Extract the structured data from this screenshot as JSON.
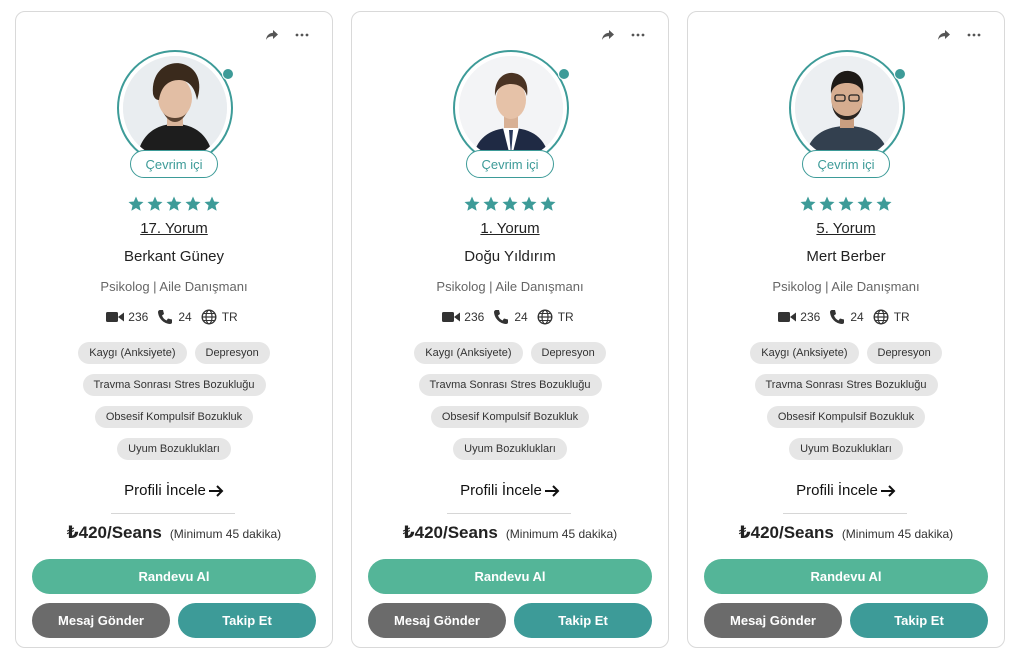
{
  "counselors": [
    {
      "status": "Çevrim içi",
      "reviews": "17. Yorum",
      "name": "Berkant Güney",
      "title": "Psikolog | Aile Danışmanı",
      "video_count": "236",
      "call_count": "24",
      "language": "TR",
      "tags": [
        "Kaygı (Anksiyete)",
        "Depresyon",
        "Travma Sonrası Stres Bozukluğu",
        "Obsesif Kompulsif Bozukluk",
        "Uyum Bozuklukları"
      ],
      "profile_link": "Profili İncele",
      "price": "₺420/Seans",
      "price_note": "(Minimum 45 dakika)",
      "book_label": "Randevu Al",
      "message_label": "Mesaj Gönder",
      "follow_label": "Takip Et"
    },
    {
      "status": "Çevrim içi",
      "reviews": "1. Yorum",
      "name": "Doğu Yıldırım",
      "title": "Psikolog | Aile Danışmanı",
      "video_count": "236",
      "call_count": "24",
      "language": "TR",
      "tags": [
        "Kaygı (Anksiyete)",
        "Depresyon",
        "Travma Sonrası Stres Bozukluğu",
        "Obsesif Kompulsif Bozukluk",
        "Uyum Bozuklukları"
      ],
      "profile_link": "Profili İncele",
      "price": "₺420/Seans",
      "price_note": "(Minimum 45 dakika)",
      "book_label": "Randevu Al",
      "message_label": "Mesaj Gönder",
      "follow_label": "Takip Et"
    },
    {
      "status": "Çevrim içi",
      "reviews": "5. Yorum",
      "name": "Mert Berber",
      "title": "Psikolog | Aile Danışmanı",
      "video_count": "236",
      "call_count": "24",
      "language": "TR",
      "tags": [
        "Kaygı (Anksiyete)",
        "Depresyon",
        "Travma Sonrası Stres Bozukluğu",
        "Obsesif Kompulsif Bozukluk",
        "Uyum Bozuklukları"
      ],
      "profile_link": "Profili İncele",
      "price": "₺420/Seans",
      "price_note": "(Minimum 45 dakika)",
      "book_label": "Randevu Al",
      "message_label": "Mesaj Gönder",
      "follow_label": "Takip Et"
    }
  ],
  "colors": {
    "accent": "#3d9b98",
    "book_button": "#54b598",
    "message_button": "#6b6b6b",
    "tag_bg": "#e6e6e6"
  },
  "icons": [
    "share-icon",
    "more-icon",
    "video-icon",
    "phone-icon",
    "globe-icon",
    "star-icon",
    "arrow-right-icon"
  ]
}
